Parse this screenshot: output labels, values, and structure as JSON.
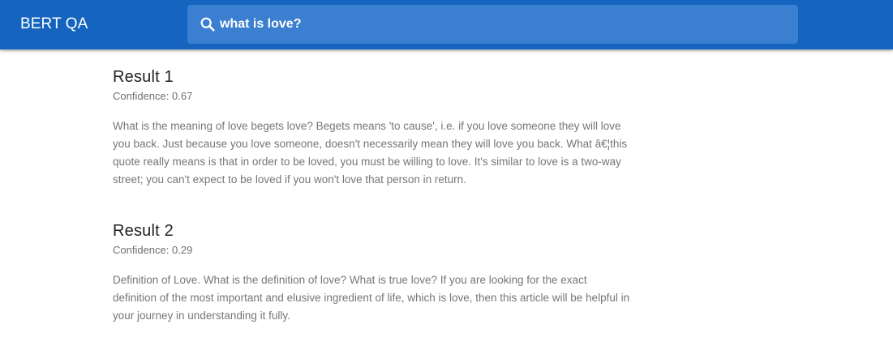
{
  "app": {
    "title": "BERT QA"
  },
  "search": {
    "icon": "search-icon",
    "value": "what is love?",
    "placeholder": "Search…"
  },
  "colors": {
    "appbar": "#1565c0",
    "search_box": "#3a7fd0",
    "title_text": "#212121",
    "body_text": "#767676"
  },
  "results": [
    {
      "title": "Result 1",
      "confidence": "Confidence: 0.67",
      "text": "What is the meaning of love begets love? Begets means 'to cause', i.e. if you love someone they will love you back. Just because you love someone, doesn't necessarily mean they will love you back. What â€¦this quote really means is that in order to be loved, you must be willing to love. It's similar to love is a two-way street; you can't expect to be loved if you won't love that person in return."
    },
    {
      "title": "Result 2",
      "confidence": "Confidence: 0.29",
      "text": "Definition of Love. What is the definition of love? What is true love? If you are looking for the exact definition of the most important and elusive ingredient of life, which is love, then this article will be helpful in your journey in understanding it fully."
    }
  ]
}
